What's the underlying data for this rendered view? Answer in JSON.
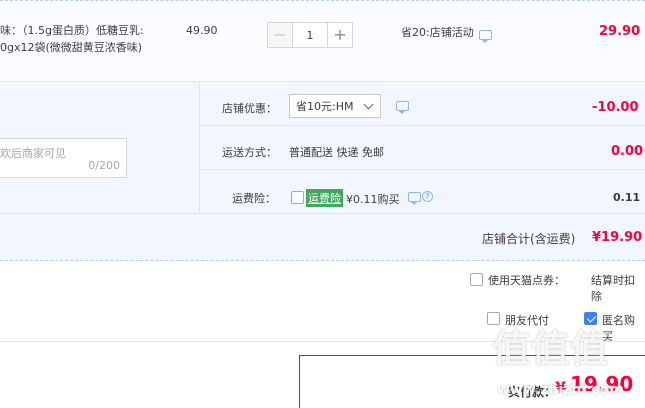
{
  "product": {
    "desc_line1": "味：（1.5g蛋白质）低糖豆乳:",
    "desc_line2": "0gx12袋(微微甜黄豆浓香味)",
    "unit_price": "49.90",
    "quantity": "1",
    "minus_label": "−",
    "plus_label": "+",
    "promo": "省20:店铺活动",
    "subtotal": "29.90"
  },
  "extras": {
    "memo_placeholder": "欢后商家可见",
    "memo_count": "0/200",
    "discount_label": "店铺优惠：",
    "discount_option": "省10元:HM",
    "discount_amount": "-10.00",
    "shipping_label": "运送方式：",
    "shipping_value": "普通配送 快递 免邮",
    "shipping_amount": "0.00",
    "insurance_label": "运费险：",
    "insurance_badge": "运费险",
    "insurance_text": "¥0.11购买",
    "insurance_amount": "0.11",
    "help_glyph": "?"
  },
  "shop_total": {
    "label": "店铺合计(含运费)",
    "amount": "¥19.90"
  },
  "options": {
    "tmall_points_label": "使用天猫点券：",
    "tmall_points_value": "结算时扣除",
    "friend_pay_label": "朋友代付",
    "anonymous_label": "匿名购买"
  },
  "submit": {
    "label": "实付款：",
    "currency": "¥",
    "amount": "19.90"
  },
  "watermark": {
    "main": "值值值",
    "sub": "www.zhizhi.com"
  }
}
